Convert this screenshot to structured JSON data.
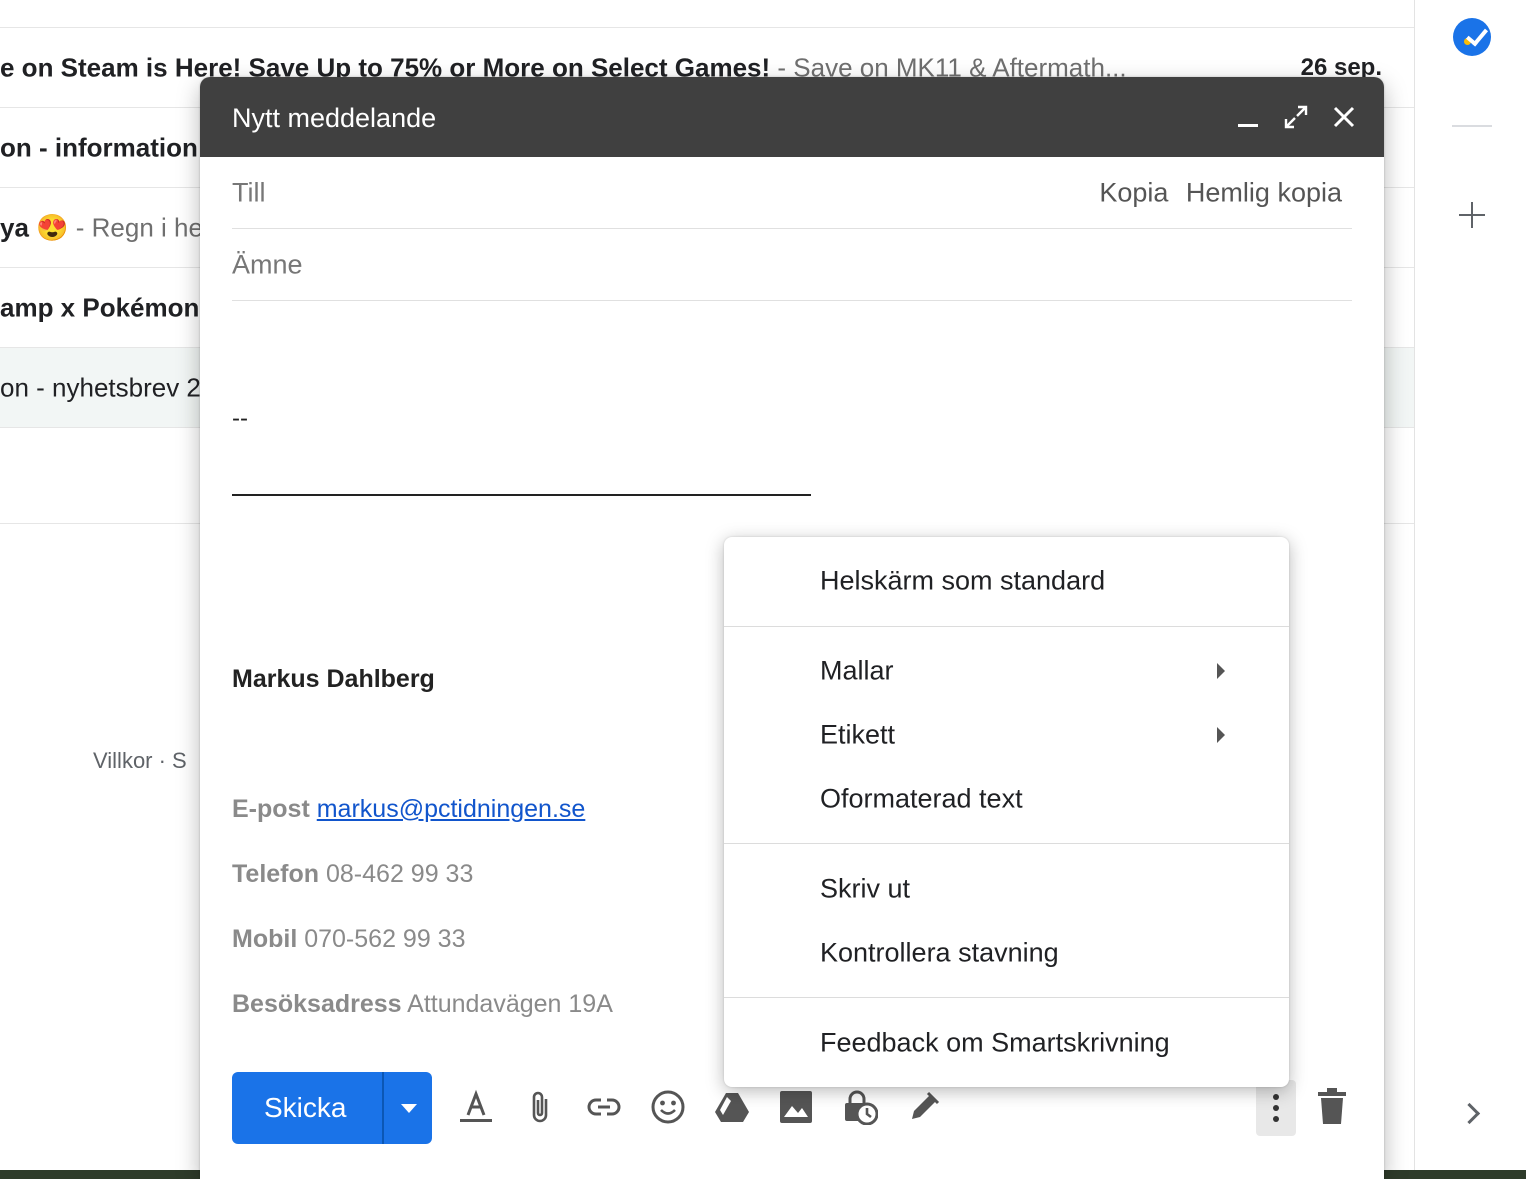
{
  "inbox": {
    "rows": [
      {
        "subject": "",
        "snippet": "",
        "date": ""
      },
      {
        "subject": "e on Steam is Here! Save Up to 75% or More on Select Games!",
        "snippet": " - Save on MK11 & Aftermath...",
        "date": "26 sep."
      },
      {
        "subject": "on - information",
        "snippet": "",
        "date": ""
      },
      {
        "subject": "ya 😍",
        "snippet": " - Regn i he",
        "date": ""
      },
      {
        "subject": "amp x Pokémon",
        "snippet": "",
        "date": ""
      },
      {
        "subject": "on - nyhetsbrev 2",
        "snippet": "",
        "date": ""
      }
    ],
    "footer_links": "Villkor · S"
  },
  "side_panel": {
    "icons": [
      "tasks-icon",
      "add-icon",
      "expand-icon"
    ]
  },
  "compose": {
    "title": "Nytt meddelande",
    "header_icons": [
      "minimize-icon",
      "fullscreen-icon",
      "close-icon"
    ],
    "to_label": "Till",
    "cc_label": "Kopia",
    "bcc_label": "Hemlig kopia",
    "subject_placeholder": "Ämne",
    "signature": {
      "dash": "--",
      "name": "Markus Dahlberg",
      "email_label": "E-post",
      "email": "markus@pctidningen.se",
      "phone_label": "Telefon",
      "phone": "08-462 99 33",
      "mobile_label": "Mobil",
      "mobile": "070-562 99 33",
      "address_label": "Besöksadress",
      "address": "Attundavägen 19A"
    },
    "toolbar": {
      "send_label": "Skicka",
      "tools": [
        "format-text-icon",
        "attach-icon",
        "link-icon",
        "emoji-icon",
        "drive-icon",
        "photo-icon",
        "confidential-mode-icon",
        "signature-icon"
      ],
      "more_icon": "more-options-icon",
      "delete_icon": "trash-icon"
    }
  },
  "menu": {
    "items": [
      {
        "label": "Helskärm som standard",
        "has_submenu": false
      },
      {
        "label": "Mallar",
        "has_submenu": true
      },
      {
        "label": "Etikett",
        "has_submenu": true
      },
      {
        "label": "Oformaterad text",
        "has_submenu": false
      },
      {
        "label": "Skriv ut",
        "has_submenu": false
      },
      {
        "label": "Kontrollera stavning",
        "has_submenu": false
      },
      {
        "label": "Feedback om Smartskrivning",
        "has_submenu": false
      }
    ]
  },
  "colors": {
    "send_button": "#1a73e8",
    "compose_header": "#404040",
    "link": "#1155cc"
  }
}
